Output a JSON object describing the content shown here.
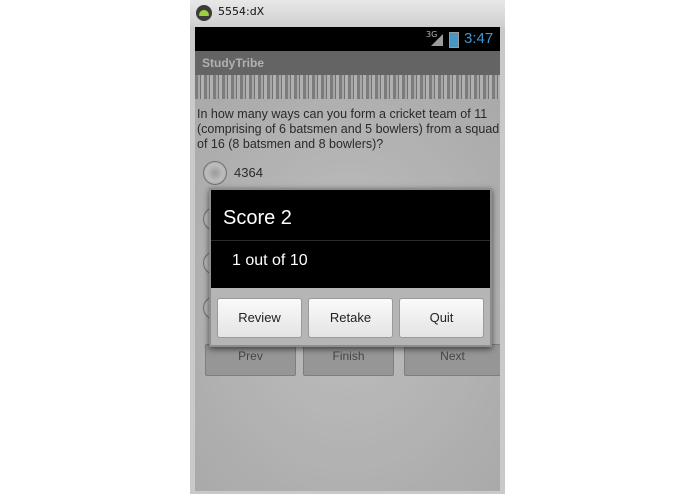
{
  "emulator": {
    "title": "5554:dX"
  },
  "status_bar": {
    "network": "3G",
    "time": "3:47"
  },
  "app": {
    "title": "StudyTribe"
  },
  "question": {
    "text": "In how many ways can you form a cricket team of 11 (comprising of 6 batsmen and 5 bowlers) from a squad of 16 (8 batsmen and 8 bowlers)?",
    "options": [
      "4364"
    ]
  },
  "nav": {
    "prev": "Prev",
    "finish": "Finish",
    "next": "Next"
  },
  "dialog": {
    "title": "Score 2",
    "message": "1 out of 10",
    "buttons": {
      "review": "Review",
      "retake": "Retake",
      "quit": "Quit"
    }
  }
}
